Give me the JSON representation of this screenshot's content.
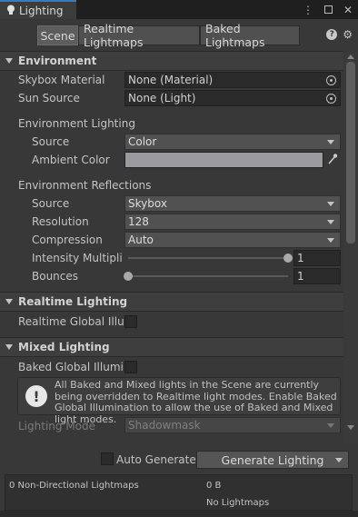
{
  "window": {
    "tab_title": "Lighting",
    "menu_icon": "kebab-icon",
    "maximize_icon": "square-icon",
    "close_icon": "close-icon"
  },
  "toolbar": {
    "tabs": [
      "Scene",
      "Realtime Lightmaps",
      "Baked Lightmaps"
    ],
    "active_tab": "Scene",
    "help_glyph": "?",
    "settings_glyph": "⚙"
  },
  "environment": {
    "header": "Environment",
    "skybox_material": {
      "label": "Skybox Material",
      "value": "None (Material)"
    },
    "sun_source": {
      "label": "Sun Source",
      "value": "None (Light)"
    },
    "env_lighting_label": "Environment Lighting",
    "source": {
      "label": "Source",
      "value": "Color"
    },
    "ambient_color": {
      "label": "Ambient Color",
      "color": "#9a9aa0"
    },
    "env_reflections_label": "Environment Reflections",
    "refl_source": {
      "label": "Source",
      "value": "Skybox"
    },
    "resolution": {
      "label": "Resolution",
      "value": "128"
    },
    "compression": {
      "label": "Compression",
      "value": "Auto"
    },
    "intensity": {
      "label": "Intensity Multiplie",
      "value": "1",
      "fraction": 1.0
    },
    "bounces": {
      "label": "Bounces",
      "value": "1",
      "fraction": 0.0
    }
  },
  "realtime": {
    "header": "Realtime Lighting",
    "gi_label": "Realtime Global Illum",
    "gi_checked": false
  },
  "mixed": {
    "header": "Mixed Lighting",
    "baked_label": "Baked Global Illumin",
    "baked_checked": false,
    "help_icon": "!",
    "help_text": "All Baked and Mixed lights in the Scene are currently being overridden to Realtime light modes. Enable Baked Global Illumination to allow the use of Baked and Mixed light modes.",
    "lighting_mode": {
      "label": "Lighting Mode",
      "value": "Shadowmask"
    }
  },
  "bottom": {
    "auto_generate_label": "Auto Generate",
    "auto_generate_checked": false,
    "generate_button": "Generate Lighting",
    "stats_left": "0 Non-Directional Lightmaps",
    "stats_size": "0 B",
    "stats_note": "No Lightmaps"
  },
  "colors": {
    "accent": "#3a79bb",
    "panel": "#383838",
    "field": "#2a2a2a"
  }
}
